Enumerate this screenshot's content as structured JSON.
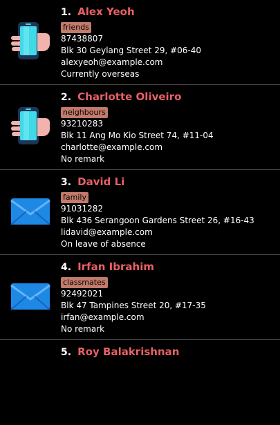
{
  "persons": [
    {
      "index": "1.",
      "name": "Alex Yeoh",
      "tag": "friends",
      "phone": "87438807",
      "address": "Blk 30 Geylang Street 29, #06-40",
      "email": "alexyeoh@example.com",
      "remark": "Currently overseas",
      "icon": "phone-icon"
    },
    {
      "index": "2.",
      "name": "Charlotte Oliveiro",
      "tag": "neighbours",
      "phone": "93210283",
      "address": "Blk 11 Ang Mo Kio Street 74, #11-04",
      "email": "charlotte@example.com",
      "remark": "No remark",
      "icon": "phone-icon"
    },
    {
      "index": "3.",
      "name": "David Li",
      "tag": "family",
      "phone": "91031282",
      "address": "Blk 436 Serangoon Gardens Street 26, #16-43",
      "email": "lidavid@example.com",
      "remark": "On leave of absence",
      "icon": "email-icon"
    },
    {
      "index": "4.",
      "name": "Irfan Ibrahim",
      "tag": "classmates",
      "phone": "92492021",
      "address": "Blk 47 Tampines Street 20, #17-35",
      "email": "irfan@example.com",
      "remark": "No remark",
      "icon": "email-icon"
    },
    {
      "index": "5.",
      "name": "Roy Balakrishnan"
    }
  ],
  "colors": {
    "background": "#000000",
    "name": "#e86066",
    "tag_background": "#c17a6b",
    "divider": "#4a4a4a"
  }
}
